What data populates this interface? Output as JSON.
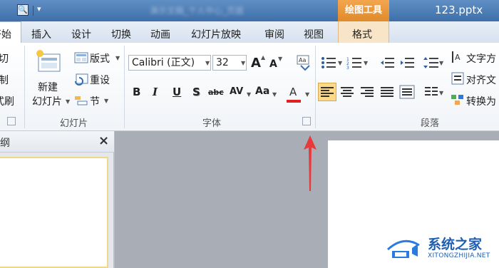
{
  "window": {
    "blurred_title": "演示文稿_个人中心_页面",
    "context_tab_title": "绘图工具",
    "doc_title": "123.pptx"
  },
  "tabs": [
    {
      "label": "开始"
    },
    {
      "label": "插入"
    },
    {
      "label": "设计"
    },
    {
      "label": "切换"
    },
    {
      "label": "动画"
    },
    {
      "label": "幻灯片放映"
    },
    {
      "label": "审阅"
    },
    {
      "label": "视图"
    },
    {
      "label": "格式"
    }
  ],
  "home_tab_visible": "开始",
  "clipboard": {
    "cut": "切",
    "copy": "制",
    "painter": "式刷"
  },
  "slides_group": {
    "new_slide_line1": "新建",
    "new_slide_line2": "幻灯片",
    "layout": "版式",
    "reset": "重设",
    "section": "节",
    "label": "幻灯片"
  },
  "font_group": {
    "font_name": "Calibri (正文)",
    "font_size": "32",
    "grow": "A",
    "shrink": "A",
    "bold": "B",
    "italic": "I",
    "underline": "U",
    "shadow": "S",
    "strike": "abc",
    "spacing": "AV",
    "case": "Aa",
    "color_a": "A",
    "label": "字体"
  },
  "paragraph_group": {
    "text_direction": "文字方",
    "align_text": "对齐文",
    "convert": "转换为",
    "label": "段落"
  },
  "left_pane": {
    "tab_label": "纲",
    "close": "×"
  },
  "watermark": {
    "name": "系统之家",
    "url": "XITONGZHIJIA.NET"
  },
  "colors": {
    "accent": "#e08a2b",
    "title_bar": "#4a7ab5",
    "arrow": "#e83a3a",
    "active_align": "#ffd98a"
  }
}
